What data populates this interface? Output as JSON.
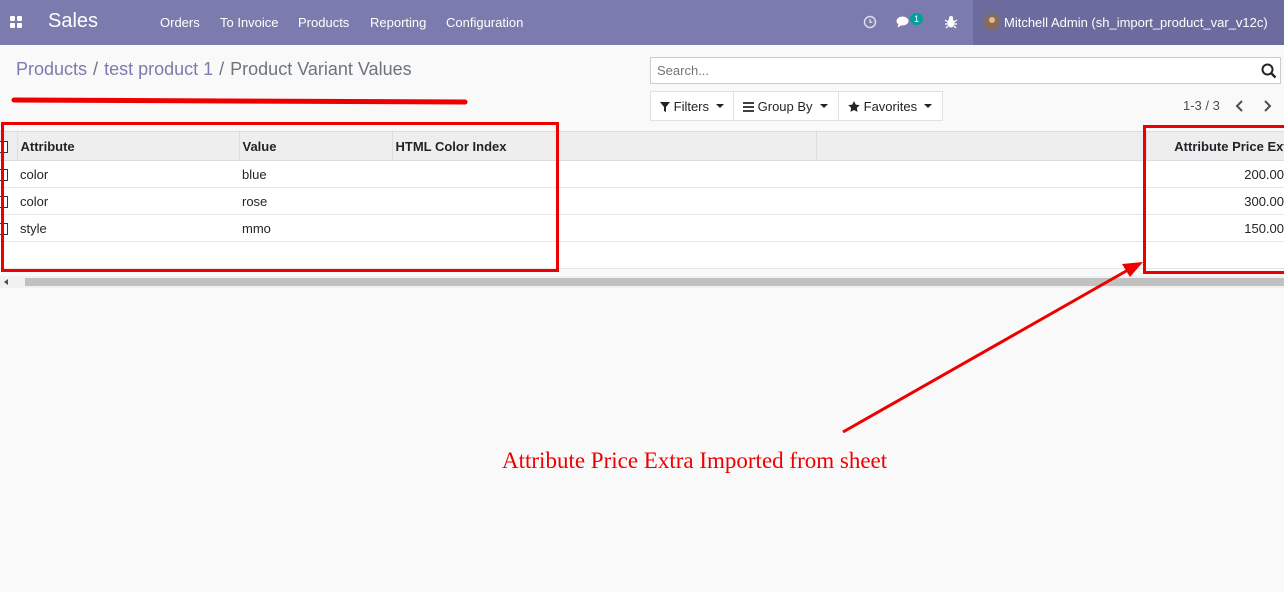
{
  "navbar": {
    "brand": "Sales",
    "menu": [
      "Orders",
      "To Invoice",
      "Products",
      "Reporting",
      "Configuration"
    ],
    "chat_badge": "1",
    "user": "Mitchell Admin (sh_import_product_var_v12c)"
  },
  "breadcrumb": [
    "Products",
    "test product 1",
    "Product Variant Values"
  ],
  "search": {
    "placeholder": "Search..."
  },
  "buttons": {
    "filters": "Filters",
    "group_by": "Group By",
    "favorites": "Favorites"
  },
  "pager": "1-3 / 3",
  "table": {
    "columns": [
      "Attribute",
      "Value",
      "HTML Color Index",
      "",
      "Attribute Price Extra"
    ],
    "rows": [
      {
        "attribute": "color",
        "value": "blue",
        "html_color": "",
        "price_extra": "200.00"
      },
      {
        "attribute": "color",
        "value": "rose",
        "html_color": "",
        "price_extra": "300.00"
      },
      {
        "attribute": "style",
        "value": "mmo",
        "html_color": "",
        "price_extra": "150.00"
      }
    ]
  },
  "annotation": {
    "text": "Attribute Price Extra Imported from sheet",
    "color": "#ee0000"
  },
  "colors": {
    "navbar": "#7c7bad",
    "accent": "#7c7bad"
  },
  "icons": [
    "apps-icon",
    "clock-icon",
    "chat-icon",
    "bug-icon",
    "search-icon",
    "filter-icon",
    "list-icon",
    "star-icon",
    "chevron-left-icon",
    "chevron-right-icon"
  ]
}
